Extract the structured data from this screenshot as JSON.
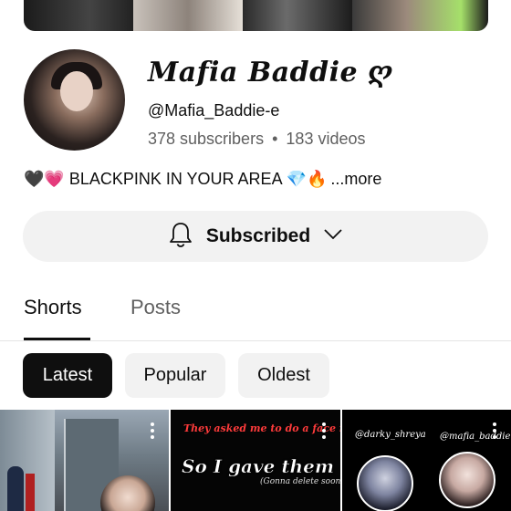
{
  "channel": {
    "name": "Mafia Baddie ღ",
    "handle": "@Mafia_Baddie-e",
    "subscribers": "378 subscribers",
    "separator": "•",
    "videos": "183 videos",
    "description": "🖤💗 BLACKPINK IN YOUR AREA 💎🔥",
    "more_label": "...more"
  },
  "subscribe": {
    "label": "Subscribed",
    "bell_icon": "bell-icon",
    "chevron_icon": "chevron-down-icon"
  },
  "tabs": [
    {
      "label": "Shorts",
      "active": true
    },
    {
      "label": "Posts",
      "active": false
    }
  ],
  "filters": [
    {
      "label": "Latest",
      "selected": true
    },
    {
      "label": "Popular",
      "selected": false
    },
    {
      "label": "Oldest",
      "selected": false
    }
  ],
  "shorts": [
    {
      "captions": []
    },
    {
      "captions": [
        "They asked me to do a face reveal",
        "So I gave them an",
        "(Gonna delete soon)"
      ]
    },
    {
      "captions": [
        "@darky_shreya",
        "@mafia_baddie"
      ]
    }
  ],
  "colors": {
    "text": "#0f0f0f",
    "secondary_text": "#606060",
    "chip_bg": "#f2f2f2",
    "chip_selected_bg": "#0f0f0f",
    "caption_red": "#ff3b3b"
  }
}
